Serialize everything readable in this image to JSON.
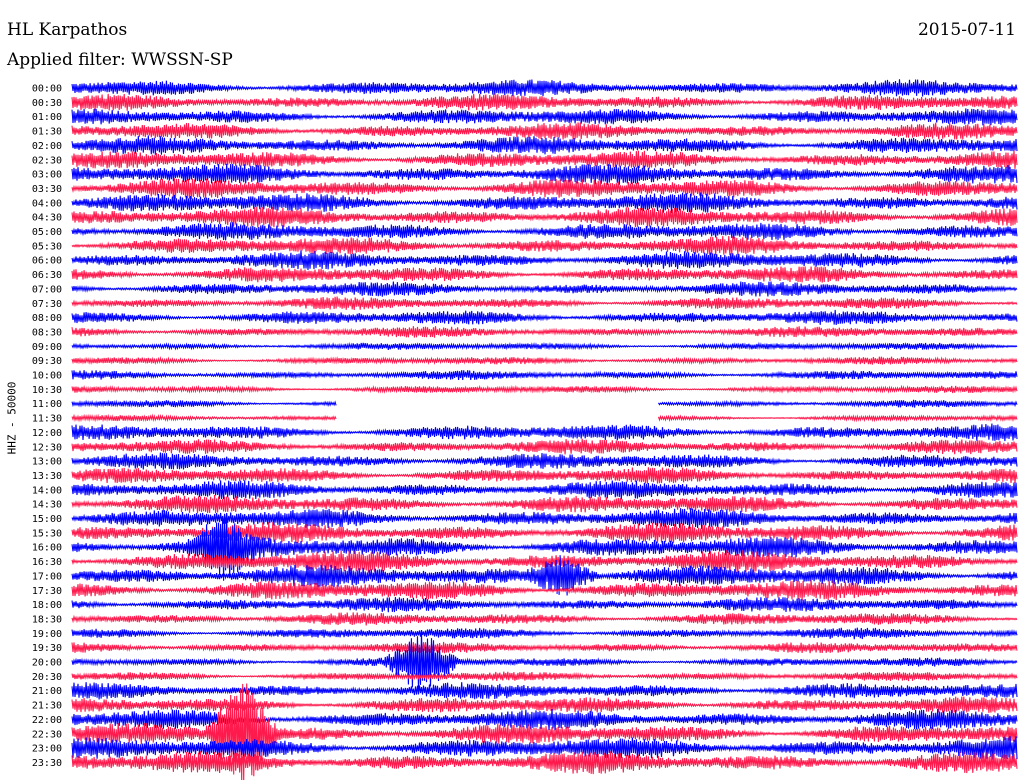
{
  "header": {
    "station": "HL Karpathos",
    "date": "2015-07-11",
    "filter": "Applied filter: WWSSN-SP"
  },
  "chart_data": {
    "type": "line",
    "title": "HL Karpathos",
    "ylabel": "HHZ - 50000",
    "colors": {
      "even_rows": "#0000ff",
      "odd_rows": "#ff1a4d"
    },
    "grid": false,
    "tick_labels": [
      "00:00",
      "00:30",
      "01:00",
      "01:30",
      "02:00",
      "02:30",
      "03:00",
      "03:30",
      "04:00",
      "04:30",
      "05:00",
      "05:30",
      "06:00",
      "06:30",
      "07:00",
      "07:30",
      "08:00",
      "08:30",
      "09:00",
      "09:30",
      "10:00",
      "10:30",
      "11:00",
      "11:30",
      "12:00",
      "12:30",
      "13:00",
      "13:30",
      "14:00",
      "14:30",
      "15:00",
      "15:30",
      "16:00",
      "16:30",
      "17:00",
      "17:30",
      "18:00",
      "18:30",
      "19:00",
      "19:30",
      "20:00",
      "20:30",
      "21:00",
      "21:30",
      "22:00",
      "22:30",
      "23:00",
      "23:30"
    ],
    "row_amplitude": [
      9,
      9,
      9,
      9,
      10,
      10,
      11,
      11,
      11,
      11,
      10,
      10,
      10,
      9,
      8,
      7,
      8,
      6,
      4,
      4,
      5,
      4,
      4,
      3,
      9,
      8,
      9,
      9,
      10,
      10,
      11,
      11,
      12,
      12,
      12,
      11,
      8,
      7,
      6,
      6,
      5,
      5,
      9,
      9,
      11,
      11,
      12,
      12
    ],
    "gap": {
      "rows": [
        22,
        23
      ],
      "fraction_range": [
        0.28,
        0.62
      ]
    },
    "events": [
      {
        "row": 40,
        "fraction": 0.37,
        "amplitude": 30
      },
      {
        "row": 45,
        "fraction": 0.18,
        "amplitude": 55
      },
      {
        "row": 32,
        "fraction": 0.16,
        "amplitude": 25
      },
      {
        "row": 34,
        "fraction": 0.52,
        "amplitude": 20
      }
    ]
  }
}
